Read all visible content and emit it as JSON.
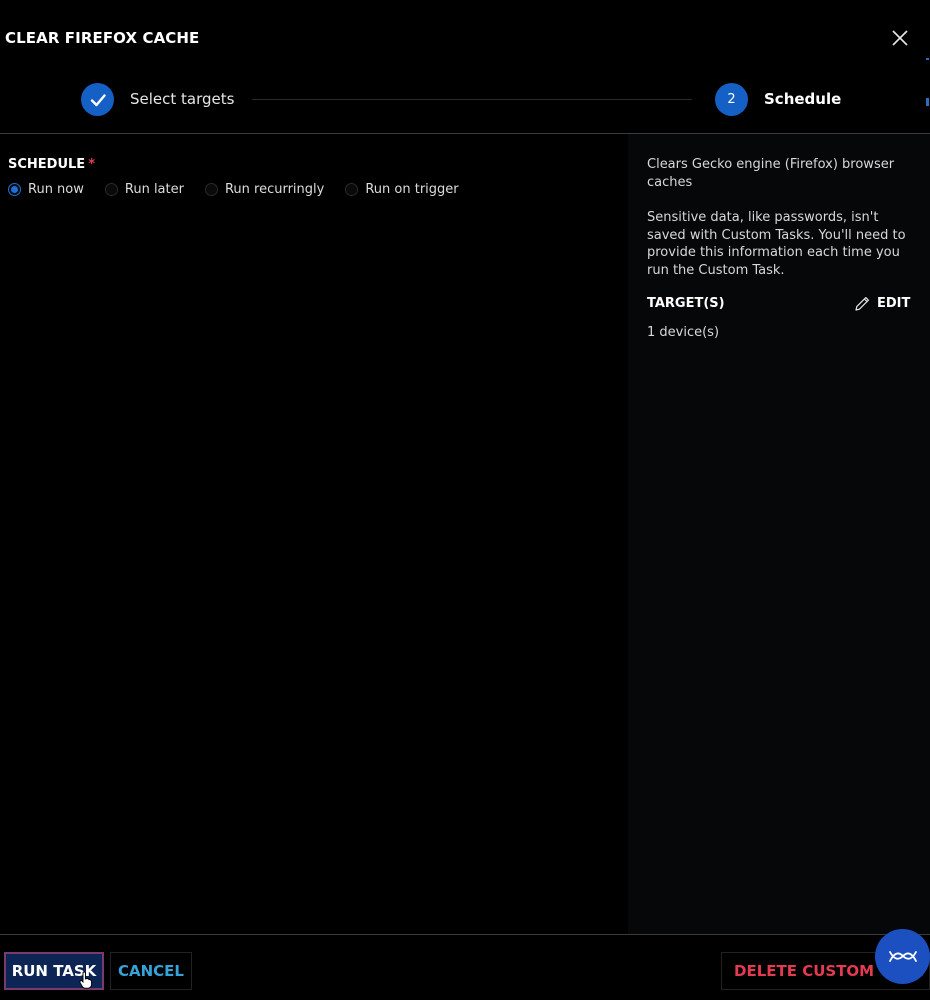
{
  "dialog": {
    "title": "CLEAR FIREFOX CACHE"
  },
  "stepper": {
    "steps": [
      {
        "label": "Select targets",
        "state": "completed",
        "icon": "check-icon"
      },
      {
        "label": "Schedule",
        "number": "2",
        "state": "active"
      }
    ]
  },
  "schedule": {
    "label": "SCHEDULE",
    "required_mark": "*",
    "options": [
      {
        "label": "Run now",
        "checked": true
      },
      {
        "label": "Run later",
        "checked": false
      },
      {
        "label": "Run recurringly",
        "checked": false
      },
      {
        "label": "Run on trigger",
        "checked": false
      }
    ]
  },
  "side": {
    "description": "Clears Gecko engine (Firefox) browser caches",
    "note": "Sensitive data, like passwords, isn't saved with Custom Tasks. You'll need to provide this information each time you run the Custom Task.",
    "targets_label": "TARGET(S)",
    "edit_label": "EDIT",
    "target_count": "1 device(s)"
  },
  "footer": {
    "run_label": "RUN TASK",
    "cancel_label": "CANCEL",
    "delete_label": "DELETE CUSTOM TASK"
  },
  "colors": {
    "accent": "#1560c4",
    "cancel": "#36a3d8",
    "danger": "#e33b4f",
    "required": "#e0404e",
    "fab": "#1c4fbf"
  },
  "icons": {
    "close": "close-icon",
    "edit": "pencil-icon",
    "fab": "wave-icon",
    "cursor": "hand-cursor-icon"
  }
}
